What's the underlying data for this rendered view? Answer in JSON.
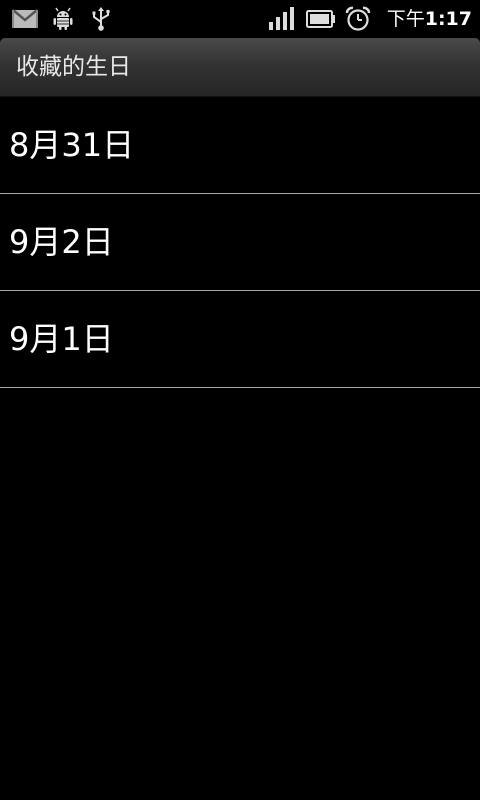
{
  "status_bar": {
    "icons": [
      "gmail-icon",
      "android-debug-icon",
      "usb-icon",
      "signal-icon",
      "battery-icon",
      "alarm-icon"
    ],
    "time_prefix": "下午",
    "time": "1:17"
  },
  "title_bar": {
    "title": "收藏的生日"
  },
  "list": {
    "items": [
      {
        "label": "8月31日"
      },
      {
        "label": "9月2日"
      },
      {
        "label": "9月1日"
      }
    ]
  }
}
